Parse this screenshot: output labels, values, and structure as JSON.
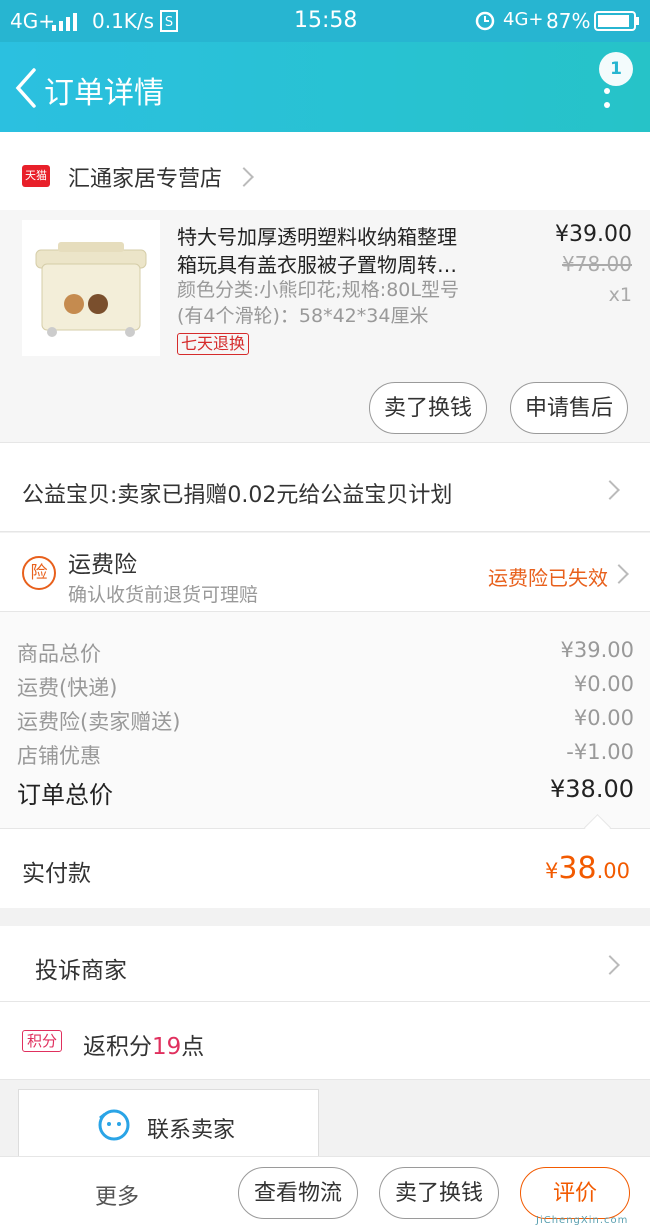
{
  "status_bar": {
    "signal": "4G+",
    "speed": "0.1K/s",
    "time": "15:58",
    "network_right": "4G+",
    "battery": "87%"
  },
  "nav": {
    "title": "订单详情",
    "badge_count": "1"
  },
  "shop": {
    "badge": "天猫",
    "name": "汇通家居专营店"
  },
  "product": {
    "title_line1": "特大号加厚透明塑料收纳箱整理",
    "title_line2": "箱玩具有盖衣服被子置物周转…",
    "spec_line1": "颜色分类:小熊印花;规格:80L型号",
    "spec_line2": "(有4个滑轮)：58*42*34厘米",
    "tag": "七天退换",
    "price": "¥39.00",
    "original_price": "¥78.00",
    "quantity": "x1"
  },
  "product_buttons": {
    "sell": "卖了换钱",
    "after_sale": "申请售后"
  },
  "charity": {
    "text": "公益宝贝:卖家已捐赠0.02元给公益宝贝计划"
  },
  "insurance": {
    "icon": "险",
    "title": "运费险",
    "subtitle": "确认收货前退货可理赔",
    "status": "运费险已失效",
    "status_color": "#e8601c"
  },
  "summary": {
    "rows": [
      {
        "label": "商品总价",
        "value": "¥39.00"
      },
      {
        "label": "运费(快递)",
        "value": "¥0.00"
      },
      {
        "label": "运费险(卖家赠送)",
        "value": "¥0.00"
      },
      {
        "label": "店铺优惠",
        "value": "-¥1.00"
      }
    ],
    "total_label": "订单总价",
    "total_value": "¥38.00"
  },
  "payment": {
    "label": "实付款",
    "currency": "¥",
    "amount_int": "38",
    "amount_dec": ".00",
    "color": "#f25a00"
  },
  "complaint": {
    "label": "投诉商家"
  },
  "points": {
    "badge": "积分",
    "prefix": "返积分",
    "count": "19",
    "suffix": "点"
  },
  "contact": {
    "label": "联系卖家"
  },
  "bottom_bar": {
    "more": "更多",
    "logistics": "查看物流",
    "sell": "卖了换钱",
    "review": "评价"
  },
  "watermark": {
    "text": "JiChengXin.com"
  }
}
